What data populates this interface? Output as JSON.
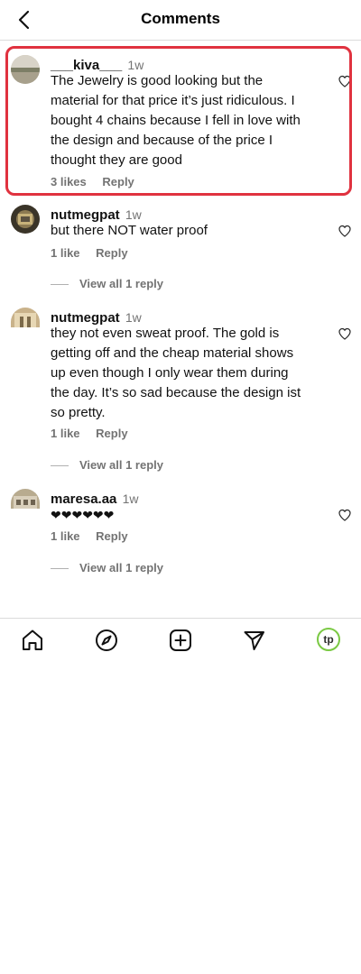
{
  "header": {
    "title": "Comments"
  },
  "comments": [
    {
      "username": "___kiva___",
      "time": "1w",
      "text": "The Jewelry is good looking but the material for that price it’s just ridiculous. I bought 4 chains because I fell in love with the design and because of the price I thought they are good",
      "likes": "3 likes",
      "reply": "Reply",
      "view_all": ""
    },
    {
      "username": "nutmegpat",
      "time": "1w",
      "text": "but there NOT water proof",
      "likes": "1 like",
      "reply": "Reply",
      "view_all": "View all 1 reply"
    },
    {
      "username": "nutmegpat",
      "time": "1w",
      "text": "they not even sweat proof. The gold is getting off and the cheap material shows up even though I only wear them during the day. It’s so sad because the design ist so pretty.",
      "likes": "1 like",
      "reply": "Reply",
      "view_all": "View all 1 reply"
    },
    {
      "username": "maresa.aa",
      "time": "1w",
      "text": "❤❤❤❤❤❤",
      "likes": "1 like",
      "reply": "Reply",
      "view_all": "View all 1 reply"
    }
  ],
  "tabbar": {
    "profile_badge": "tp"
  },
  "colors": {
    "highlight": "#e0323f",
    "badge_ring": "#7ac943",
    "muted": "#737373"
  }
}
